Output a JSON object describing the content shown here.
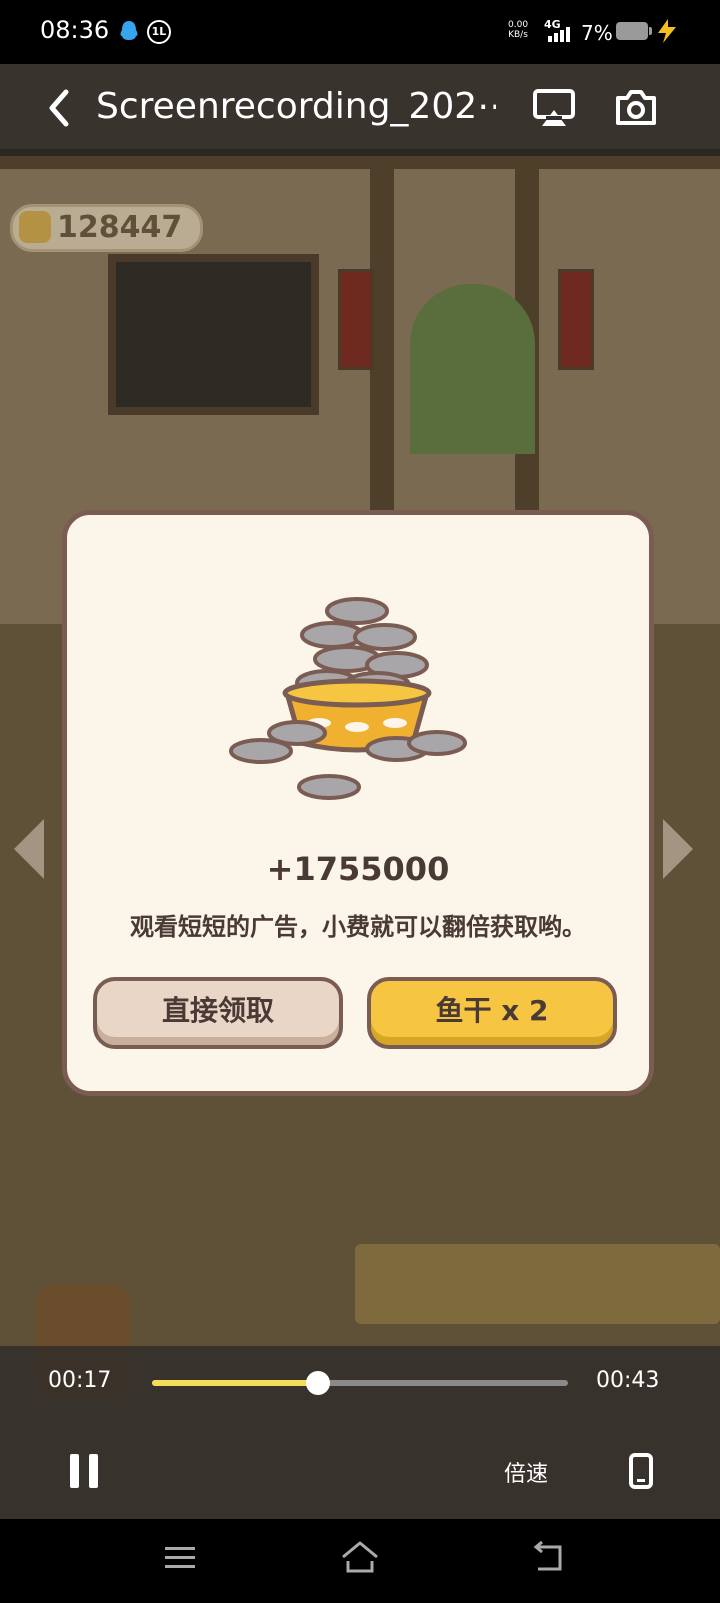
{
  "status_bar": {
    "time": "08:36",
    "net_speed_value": "0.00",
    "net_speed_unit": "KB/s",
    "network": "4G",
    "battery": "7%"
  },
  "game": {
    "currency_value": "128447"
  },
  "player": {
    "title": "Screenrecording_202⋯",
    "current_time": "00:17",
    "duration": "00:43",
    "progress": 0.4,
    "speed_label": "倍速"
  },
  "dialog": {
    "amount": "+1755000",
    "description": "观看短短的广告，小费就可以翻倍获取哟。",
    "claim_label": "直接领取",
    "double_label": "鱼干 x 2"
  },
  "colors": {
    "accent_yellow": "#f6c542",
    "dialog_bg": "#fcf5ea",
    "dialog_border": "#7a5c52",
    "progress_fill": "#f4dd5a"
  }
}
